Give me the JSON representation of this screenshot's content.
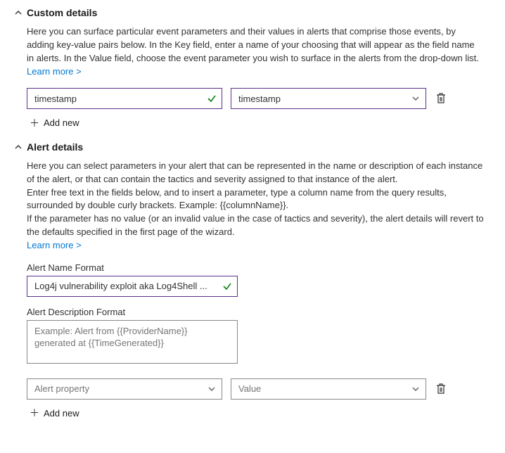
{
  "customDetails": {
    "title": "Custom details",
    "description": "Here you can surface particular event parameters and their values in alerts that comprise those events, by adding key-value pairs below. In the Key field, enter a name of your choosing that will appear as the field name in alerts. In the Value field, choose the event parameter you wish to surface in the alerts from the drop-down list.",
    "learnMore": "Learn more >",
    "keyValue": "timestamp",
    "valueValue": "timestamp",
    "addNew": "Add new"
  },
  "alertDetails": {
    "title": "Alert details",
    "descriptionPart1": "Here you can select parameters in your alert that can be represented in the name or description of each instance of the alert, or that can contain the tactics and severity assigned to that instance of the alert.",
    "descriptionPart2": "Enter free text in the fields below, and to insert a parameter, type a column name from the query results, surrounded by double curly brackets. Example: {{columnName}}.",
    "descriptionPart3": "If the parameter has no value (or an invalid value in the case of tactics and severity), the alert details will revert to the defaults specified in the first page of the wizard.",
    "learnMore": "Learn more >",
    "nameFormatLabel": "Alert Name Format",
    "nameFormatValue": "Log4j vulnerability exploit aka Log4Shell ...",
    "descFormatLabel": "Alert Description Format",
    "descFormatPlaceholder": "Example: Alert from {{ProviderName}} generated at {{TimeGenerated}}",
    "propertyPlaceholder": "Alert property",
    "valuePlaceholder": "Value",
    "addNew": "Add new"
  }
}
